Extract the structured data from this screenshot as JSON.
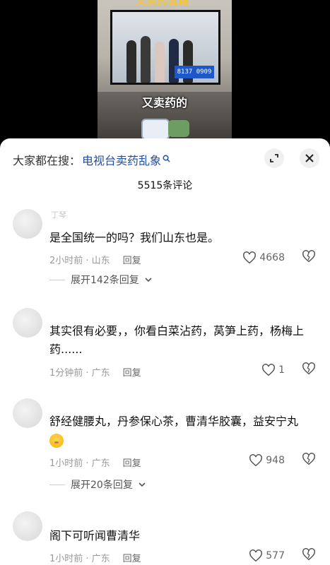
{
  "video": {
    "top_caption": "又卖药套路",
    "phone": "8137 0909",
    "subtitle": "又卖药的"
  },
  "sheet": {
    "search_prefix": "大家都在搜：",
    "search_keyword": "电视台卖药乱象",
    "comment_count": "5515条评论"
  },
  "comments": [
    {
      "nick": "丁琴",
      "text": "是全国统一的吗？我们山东也是。",
      "time_loc": "2小时前 · 山东",
      "reply": "回复",
      "likes": "4668",
      "expand": "展开142条回复"
    },
    {
      "nick": "",
      "text": "其实很有必要，，你看白菜沾药，莴笋上药，杨梅上药......",
      "time_loc": "1分钟前 · 广东",
      "reply": "回复",
      "likes": "1"
    },
    {
      "nick": "",
      "text": "舒经健腰丸，丹参保心茶，曹清华胶囊，益安宁丸",
      "time_loc": "1小时前 · 广东",
      "reply": "回复",
      "likes": "948",
      "expand": "展开20条回复"
    },
    {
      "nick": "",
      "text": "阁下可听闻曹清华",
      "time_loc": "1小时前 · 广东",
      "reply": "回复",
      "likes": "577"
    }
  ],
  "icons": {
    "search": "search-icon",
    "expand_sheet": "resize-icon",
    "close": "close-icon",
    "like": "heart-icon",
    "dislike": "broken-heart-icon",
    "chevron": "chevron-down-icon"
  }
}
